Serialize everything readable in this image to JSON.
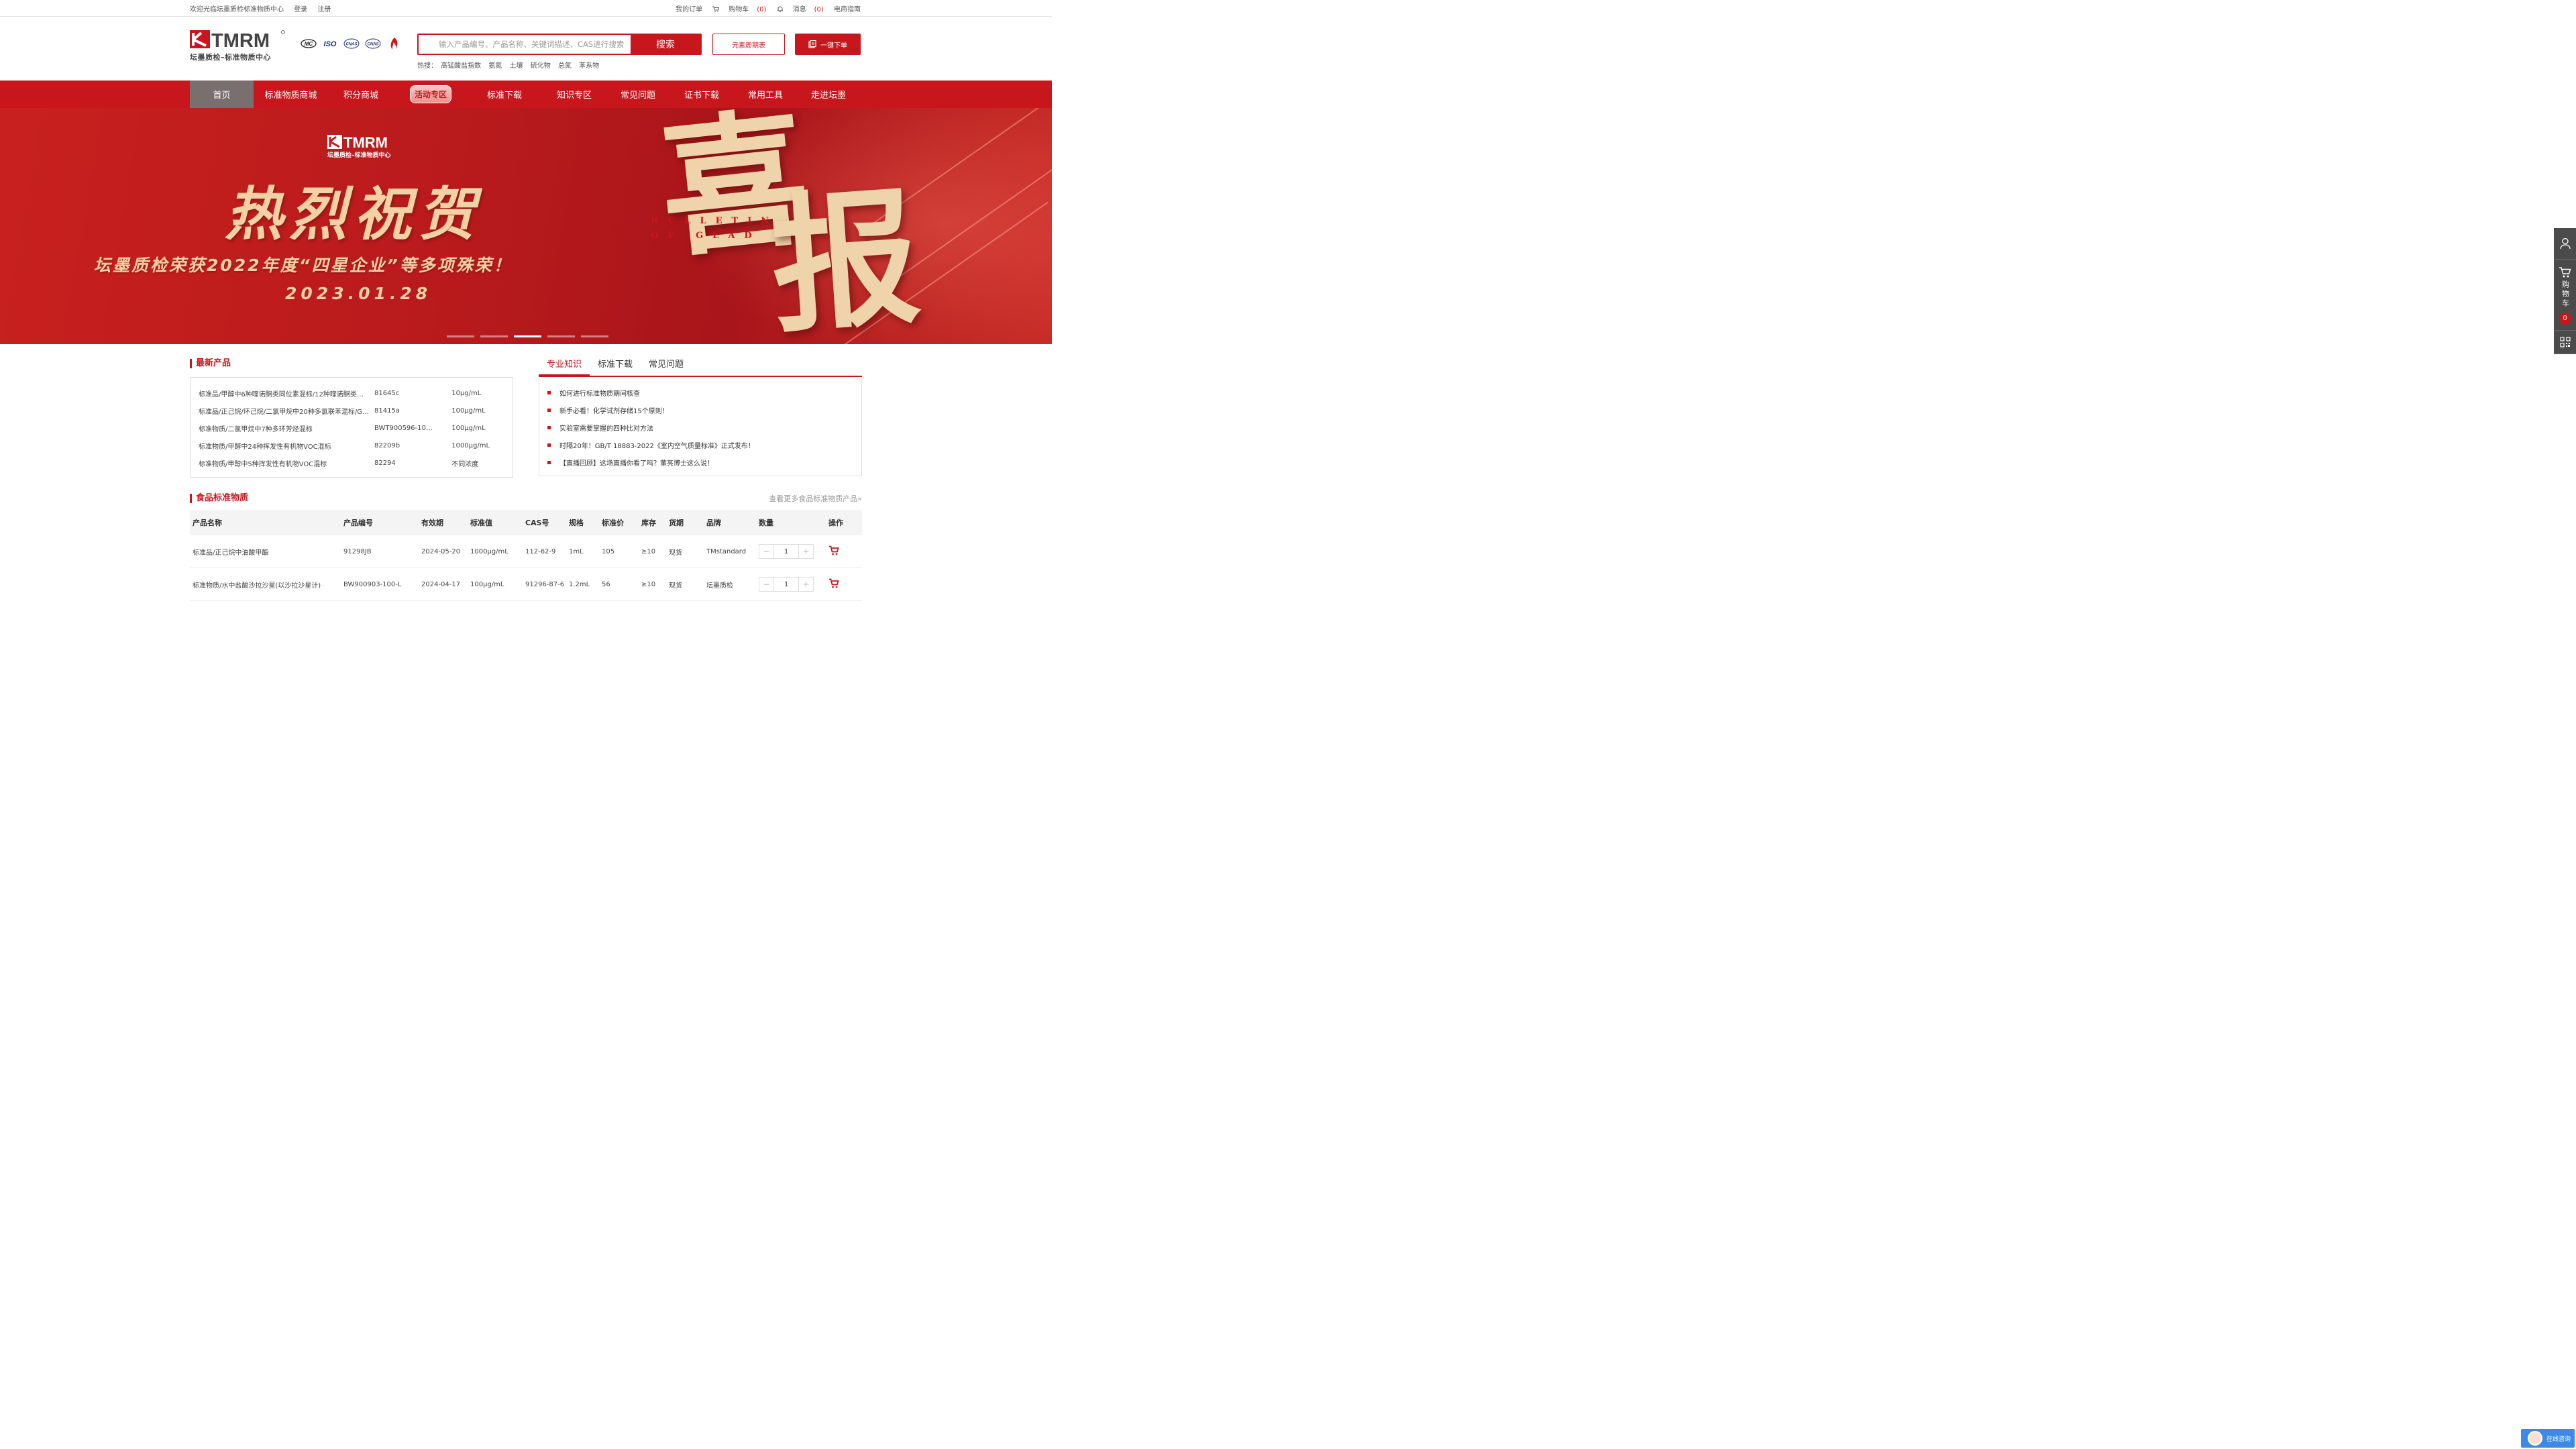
{
  "topbar": {
    "welcome": "欢迎光临坛墨质检标准物质中心",
    "login": "登录",
    "register": "注册",
    "my_orders": "我的订单",
    "cart_label": "购物车",
    "cart_count": "(0)",
    "msg_label": "消息",
    "msg_count": "(0)",
    "ecom_guide": "电商指南"
  },
  "header": {
    "logo_text": "TMRM",
    "logo_sub": "坛墨质检–标准物质中心",
    "certs": [
      "MC",
      "ISO",
      "CNAS",
      "CNAS"
    ],
    "search_placeholder": "输入产品编号、产品名称、关键词描述、CAS进行搜索",
    "search_button": "搜索",
    "hot_label": "热搜：",
    "hot_terms": [
      "高锰酸盐指数",
      "氨氮",
      "土壤",
      "硫化物",
      "总氮",
      "苯系物"
    ],
    "periodic_table": "元素周期表",
    "one_click_order": "一键下单"
  },
  "nav": [
    "首页",
    "标准物质商城",
    "积分商城",
    "活动专区",
    "标准下载",
    "知识专区",
    "常见问题",
    "证书下载",
    "常用工具",
    "走进坛墨"
  ],
  "banner": {
    "logo_text": "TMRM",
    "logo_sub": "坛墨质检–标准物质中心",
    "title": "热烈祝贺",
    "subtitle": "坛墨质检荣获2022年度“四星企业”等多项殊荣！",
    "date": "2023.01.28",
    "big_char_1": "喜",
    "big_char_2": "报",
    "english": "BULLETIN OF GLAD",
    "slide_count": 5,
    "active_slide": 3
  },
  "sidebar": {
    "cart_label": "购物车",
    "cart_count": "0"
  },
  "latest": {
    "title": "最新产品",
    "rows": [
      {
        "name": "标准品/甲醇中6种喹诺酮类同位素混标/12种喹诺酮类…",
        "code": "81645c",
        "conc": "10μg/mL"
      },
      {
        "name": "标准品/正己烷/环己烷/二氯甲烷中20种多氯联苯混标/G…",
        "code": "81415a",
        "conc": "100μg/mL"
      },
      {
        "name": "标准物质/二氯甲烷中7种多环芳烃混标",
        "code": "BWT900596-10…",
        "conc": "100μg/mL"
      },
      {
        "name": "标准物质/甲醇中24种挥发性有机物VOC混标",
        "code": "82209b",
        "conc": "1000μg/mL"
      },
      {
        "name": "标准物质/甲醇中5种挥发性有机物VOC混标",
        "code": "82294",
        "conc": "不同浓度"
      }
    ]
  },
  "knowledge": {
    "tabs": [
      "专业知识",
      "标准下载",
      "常见问题"
    ],
    "items": [
      "如何进行标准物质期间核查",
      "新手必看！化学试剂存储15个原则！",
      "实验室需要掌握的四种比对方法",
      "时隔20年！GB/T 18883-2022《室内空气质量标准》正式发布！",
      "【直播回顾】这场直播你看了吗？董亮博士这么说！"
    ]
  },
  "food": {
    "title": "食品标准物质",
    "more": "查看更多食品标准物质产品»",
    "columns": [
      "产品名称",
      "产品编号",
      "有效期",
      "标准值",
      "CAS号",
      "规格",
      "标准价",
      "库存",
      "货期",
      "品牌",
      "数量",
      "操作"
    ],
    "rows": [
      {
        "name": "标准品/正己烷中油酸甲酯",
        "code": "91298JB",
        "expiry": "2024-05-20",
        "value": "1000μg/mL",
        "cas": "112-62-9",
        "spec": "1mL",
        "price": "105",
        "stock": "≥10",
        "delivery": "现货",
        "brand": "TMstandard",
        "qty": "1"
      },
      {
        "name": "标准物质/水中盐酸沙拉沙星(以沙拉沙星计)",
        "code": "BW900903-100-L",
        "expiry": "2024-04-17",
        "value": "100μg/mL",
        "cas": "91296-87-6",
        "spec": "1.2mL",
        "price": "56",
        "stock": "≥10",
        "delivery": "现货",
        "brand": "坛墨质检",
        "qty": "1"
      }
    ]
  },
  "chat": {
    "label": "在线咨询"
  },
  "colors": {
    "brand_red": "#c8161d",
    "nav_active": "#7a6f6f",
    "banner_gold": "#f2d1a4",
    "sidebar_bg": "#4b4b4b",
    "chat_blue": "#3d8ae6"
  }
}
